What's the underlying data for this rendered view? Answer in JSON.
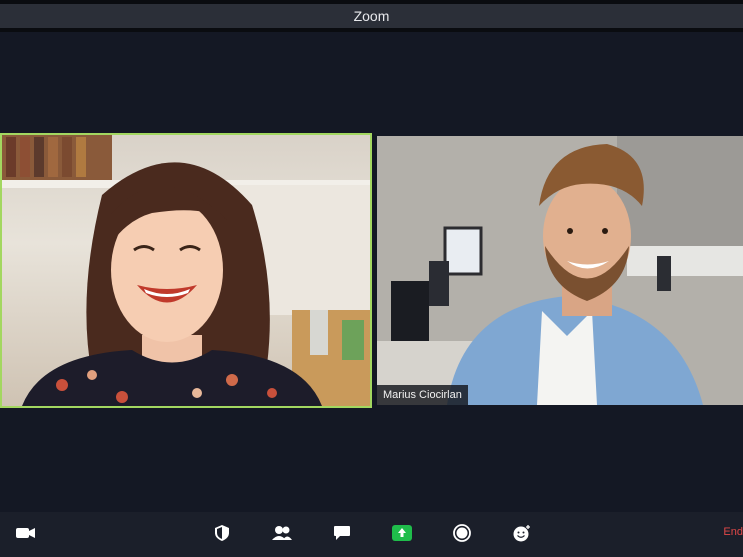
{
  "window": {
    "title": "Zoom"
  },
  "participants": [
    {
      "name": "",
      "active_speaker": true
    },
    {
      "name": "Marius Ciocirlan",
      "active_speaker": false
    }
  ],
  "toolbar": {
    "buttons": [
      {
        "icon": "video-camera-icon"
      },
      {
        "icon": "security-shield-icon"
      },
      {
        "icon": "participants-icon"
      },
      {
        "icon": "chat-icon"
      },
      {
        "icon": "share-screen-icon",
        "accent": "#1fbd4b"
      },
      {
        "icon": "record-icon"
      },
      {
        "icon": "reactions-icon"
      }
    ],
    "end_label": "End"
  },
  "colors": {
    "active_speaker_border": "#a3d760",
    "end_red": "#e04848"
  }
}
